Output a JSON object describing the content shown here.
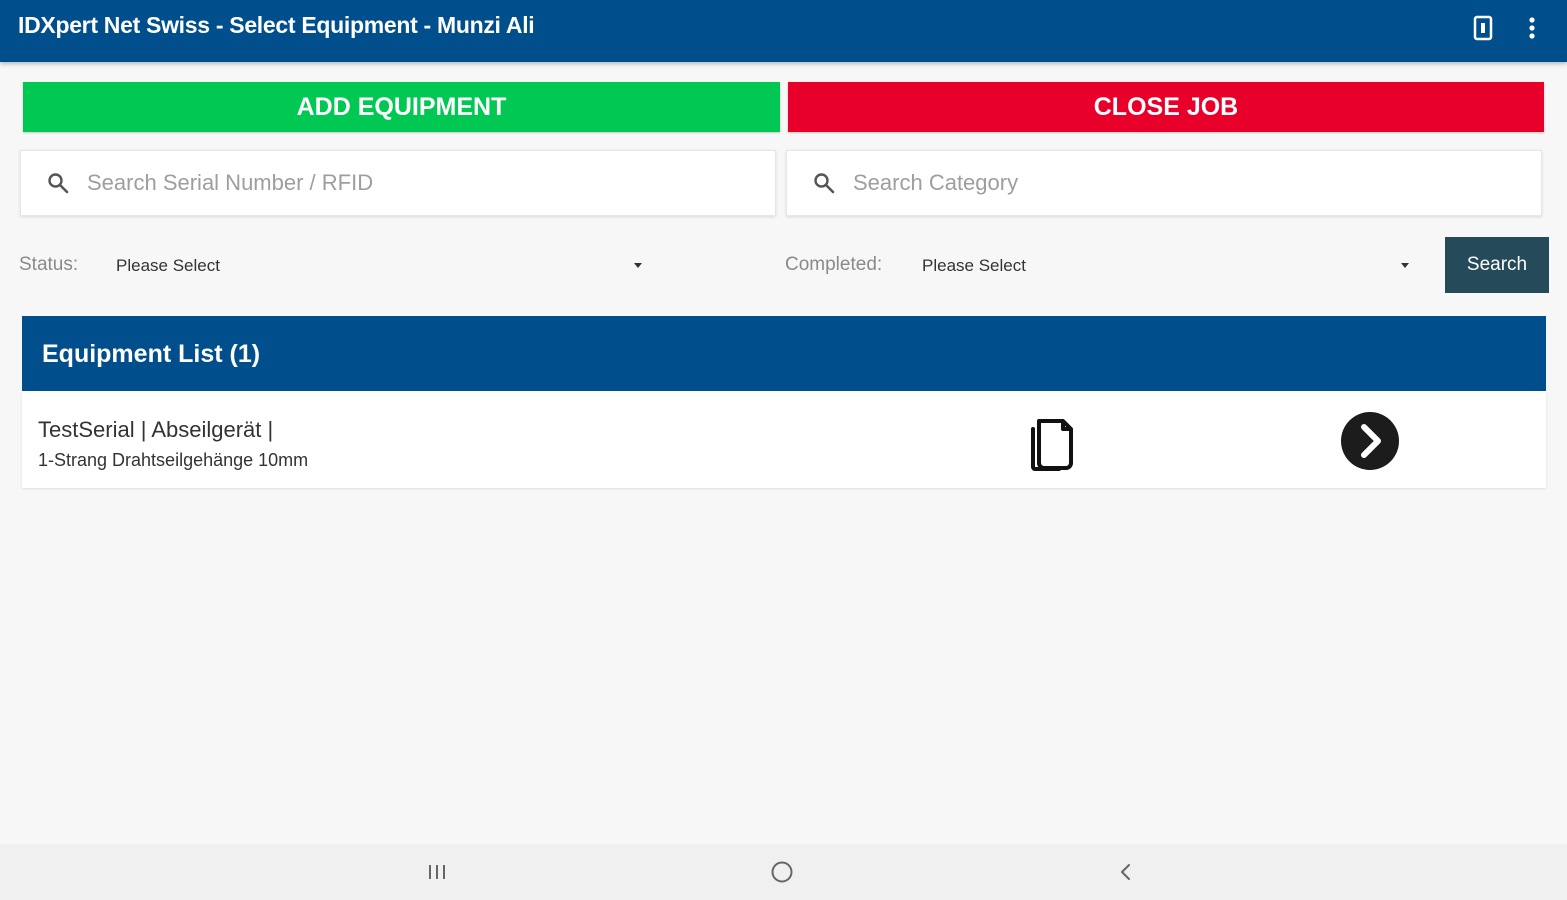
{
  "app_bar": {
    "title": "IDXpert Net Swiss - Select Equipment - Munzi Ali",
    "icons": [
      "device-icon",
      "more-vert-icon"
    ]
  },
  "actions": {
    "add_equipment": "ADD EQUIPMENT",
    "close_job": "CLOSE JOB"
  },
  "search": {
    "serial_placeholder": "Search Serial Number / RFID",
    "category_placeholder": "Search Category",
    "serial_value": "",
    "category_value": ""
  },
  "filters": {
    "status_label": "Status:",
    "status_value": "Please Select",
    "completed_label": "Completed:",
    "completed_value": "Please Select",
    "search_button": "Search"
  },
  "equipment_list": {
    "title": "Equipment List (1)",
    "items": [
      {
        "line1": "TestSerial | Abseilgerät |",
        "line2": "1-Strang Drahtseilgehänge 10mm"
      }
    ]
  },
  "colors": {
    "primary": "#004f8c",
    "add": "#00c853",
    "close": "#e8002a",
    "search_button": "#254a5a"
  },
  "nav_bar": {
    "icons": [
      "recent-apps-icon",
      "home-icon",
      "back-icon"
    ]
  }
}
